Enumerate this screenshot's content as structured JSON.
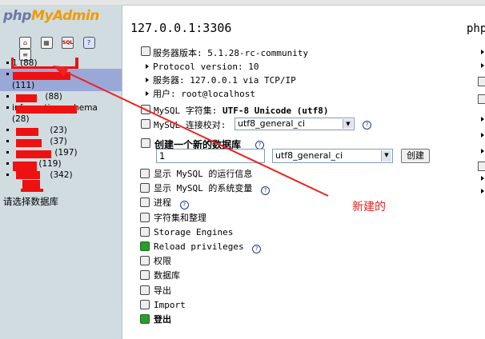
{
  "nav": {
    "logo_php": "php",
    "logo_my": "My",
    "logo_admin": "Admin",
    "icons": [
      "home-icon",
      "table-icon",
      "sql-icon",
      "query-icon",
      "help-docs-icon"
    ],
    "databases": [
      {
        "label": "1",
        "count": "(88)"
      },
      {
        "label": "",
        "count": "(111)"
      },
      {
        "label": "",
        "count": "(88)"
      },
      {
        "label": "information_schema",
        "count": "(28)"
      },
      {
        "label": "",
        "count": "(23)"
      },
      {
        "label": "",
        "count": "(37)"
      },
      {
        "label": "",
        "count": "(197)"
      },
      {
        "label": "",
        "count": "(119)"
      },
      {
        "label": "",
        "count": "(342)"
      }
    ],
    "select_prompt": "请选择数据库"
  },
  "main": {
    "server_title": "127.0.0.1:3306",
    "right_title": "php",
    "server_info": [
      {
        "text": "服务器版本: 5.1.28-rc-community"
      },
      {
        "text": "Protocol version: 10"
      },
      {
        "text": "服务器: 127.0.0.1 via TCP/IP"
      },
      {
        "text": "用户: root@localhost"
      }
    ],
    "charset_label": "MySQL 字符集:",
    "charset_value": "UTF-8 Unicode (utf8)",
    "collation_label": "MySQL 连接校对:",
    "collation_selected": "utf8_general_ci",
    "create_db": {
      "title": "创建一个新的数据库",
      "name_value": "1",
      "collation_selected": "utf8_general_ci",
      "button_label": "创建"
    },
    "links": [
      {
        "label": "显示 MySQL 的运行信息",
        "icon": "status-icon",
        "bold": false
      },
      {
        "label": "显示 MySQL 的系统变量",
        "icon": "variables-icon",
        "bold": false
      },
      {
        "label": "进程",
        "icon": "process-icon",
        "bold": false
      },
      {
        "label": "字符集和整理",
        "icon": "charset-icon",
        "bold": false
      },
      {
        "label": "Storage Engines",
        "icon": "engine-icon",
        "bold": false
      },
      {
        "label": "Reload privileges",
        "icon": "reload-icon",
        "bold": false
      },
      {
        "label": "权限",
        "icon": "privileges-icon",
        "bold": false
      },
      {
        "label": "数据库",
        "icon": "database-icon",
        "bold": false
      },
      {
        "label": "导出",
        "icon": "export-icon",
        "bold": false
      },
      {
        "label": "Import",
        "icon": "import-icon",
        "bold": false
      },
      {
        "label": "登出",
        "icon": "logout-icon",
        "bold": true
      }
    ],
    "annotation": "新建的",
    "colors": {
      "annotation": "#ee2222",
      "nav_bg": "#d0dce0",
      "nav_highlight": "#9aa8d8"
    }
  }
}
